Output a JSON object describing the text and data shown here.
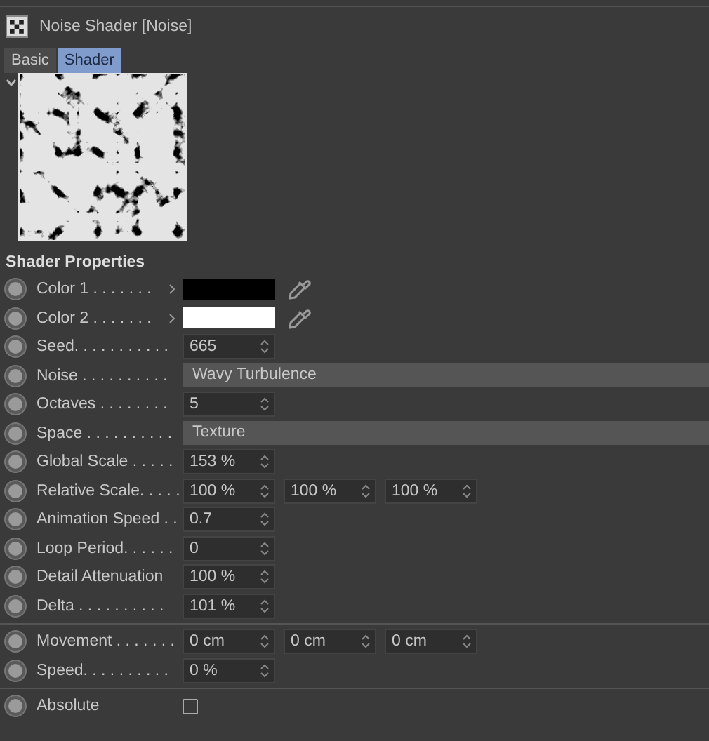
{
  "header": {
    "title": "Noise Shader [Noise]"
  },
  "tabs": [
    {
      "label": "Basic",
      "selected": false
    },
    {
      "label": "Shader",
      "selected": true
    }
  ],
  "preview": {
    "expanded": true
  },
  "section": {
    "title": "Shader Properties"
  },
  "groups": [
    [
      {
        "kind": "color",
        "label": "Color 1 . . . . . . .",
        "color": "#000000"
      },
      {
        "kind": "color",
        "label": "Color 2 . . . . . . .",
        "color": "#ffffff"
      },
      {
        "kind": "number",
        "label": "Seed. . . . . . . . . . .",
        "values": [
          "665"
        ]
      },
      {
        "kind": "dropdown",
        "label": "Noise . . . . . . . . . .",
        "value": "Wavy Turbulence"
      },
      {
        "kind": "number",
        "label": "Octaves . . . . . . . .",
        "values": [
          "5"
        ]
      },
      {
        "kind": "dropdown",
        "label": "Space . . . . . . . . . .",
        "value": "Texture"
      },
      {
        "kind": "number",
        "label": "Global Scale . . . . .",
        "values": [
          "153 %"
        ]
      },
      {
        "kind": "number",
        "label": "Relative Scale. . . . .",
        "values": [
          "100 %",
          "100 %",
          "100 %"
        ]
      },
      {
        "kind": "number",
        "label": "Animation Speed . .",
        "values": [
          "0.7"
        ]
      },
      {
        "kind": "number",
        "label": "Loop Period. . . . . .",
        "values": [
          "0"
        ]
      },
      {
        "kind": "number",
        "label": "Detail Attenuation",
        "values": [
          "100 %"
        ]
      },
      {
        "kind": "number",
        "label": "Delta . . . . . . . . . .",
        "values": [
          "101 %"
        ]
      }
    ],
    [
      {
        "kind": "number",
        "label": "Movement . . . . . . .",
        "values": [
          "0 cm",
          "0 cm",
          "0 cm"
        ]
      },
      {
        "kind": "number",
        "label": "Speed. . . . . . . . . .",
        "values": [
          "0 %"
        ]
      }
    ],
    [
      {
        "kind": "checkbox",
        "label": "Absolute",
        "checked": false
      }
    ]
  ]
}
